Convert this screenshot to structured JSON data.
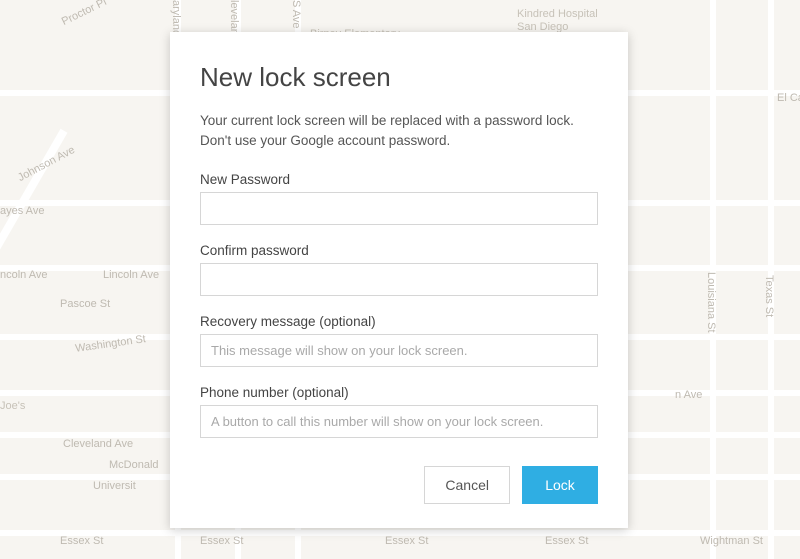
{
  "map": {
    "streets": {
      "proctor_pl": "Proctor Pl",
      "johnson_ave": "Johnson Ave",
      "hayes_ave": "ayes Ave",
      "lincoln_ave_left": "ncoln Ave",
      "lincoln_ave_center": "Lincoln Ave",
      "lincoln_ave_right": "n Ave",
      "pascoe_st": "Pascoe St",
      "washington_st": "Washington St",
      "cleveland_ave": "Cleveland Ave",
      "mcdonald_st": "McDonald",
      "university": "Universit",
      "essex_st_1": "Essex St",
      "essex_st_2": "Essex St",
      "essex_st_3": "Essex St",
      "essex_st_4": "Essex St",
      "wightman_st": "Wightman St",
      "el_cajon": "El Ca",
      "maryland_st": "aryland St",
      "s_ave": "S Ave",
      "louisiana_st": "Louisiana St",
      "texas_st": "Texas St",
      "cleveland_vert": "leveland"
    },
    "pois": {
      "kindred_hospital": "Kindred Hospital\nSan Diego",
      "birney_school": "Birney Elementary",
      "joes": "Joe's"
    }
  },
  "dialog": {
    "title": "New lock screen",
    "description": "Your current lock screen will be replaced with a password lock. Don't use your Google account password.",
    "fields": {
      "new_password": {
        "label": "New Password",
        "value": ""
      },
      "confirm_password": {
        "label": "Confirm password",
        "value": ""
      },
      "recovery_message": {
        "label": "Recovery message (optional)",
        "placeholder": "This message will show on your lock screen.",
        "value": ""
      },
      "phone_number": {
        "label": "Phone number (optional)",
        "placeholder": "A button to call this number will show on your lock screen.",
        "value": ""
      }
    },
    "buttons": {
      "cancel": "Cancel",
      "lock": "Lock"
    }
  }
}
